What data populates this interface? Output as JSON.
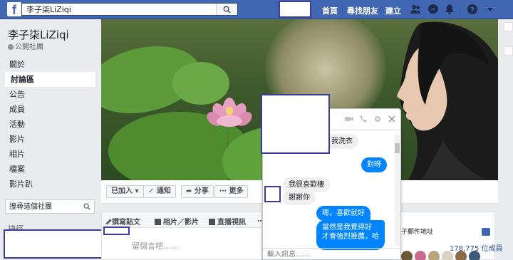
{
  "topbar": {
    "logo": "f",
    "search_value": "李子柒LiZiqi",
    "nav": [
      "首頁",
      "尋找朋友",
      "建立"
    ],
    "icons": [
      "friends-icon",
      "messenger-icon",
      "notifications-icon",
      "help-icon",
      "dropdown-icon"
    ]
  },
  "group": {
    "name": "李子柒LiZiqi",
    "privacy": "公開社團"
  },
  "sidenav": {
    "items": [
      "關於",
      "討論區",
      "公告",
      "成員",
      "活動",
      "影片",
      "相片",
      "檔案",
      "影片趴"
    ],
    "active_index": 1,
    "search_placeholder": "搜尋這個社團",
    "shortcuts_label": "捷徑"
  },
  "cover_actions": {
    "joined": "已加入",
    "notify": "通知",
    "share": "分享",
    "more": "更多"
  },
  "composer": {
    "tabs": [
      "撰寫貼文",
      "相片／影片",
      "直播視訊"
    ],
    "more_tab": "…",
    "placeholder": "留個言吧……"
  },
  "right_panel": {
    "email_label": "子郵件地址",
    "member_count": "178,775 位成員"
  },
  "chat": {
    "messages": [
      {
        "dir": "in",
        "text": "我洗衣"
      },
      {
        "dir": "out",
        "text": "對呀"
      },
      {
        "dir": "in",
        "text": "我很喜歡樓"
      },
      {
        "dir": "in",
        "text": "謝謝你"
      },
      {
        "dir": "out",
        "text": "嗯，喜歡就好"
      },
      {
        "dir": "out",
        "text": "當然是我覺得好\n才會強烈推薦，哈"
      }
    ],
    "input_placeholder": "輸入訊息……"
  },
  "colors": {
    "brand": "#4267b2",
    "messenger_blue": "#0084ff",
    "redaction_border": "#3c3ca0"
  }
}
